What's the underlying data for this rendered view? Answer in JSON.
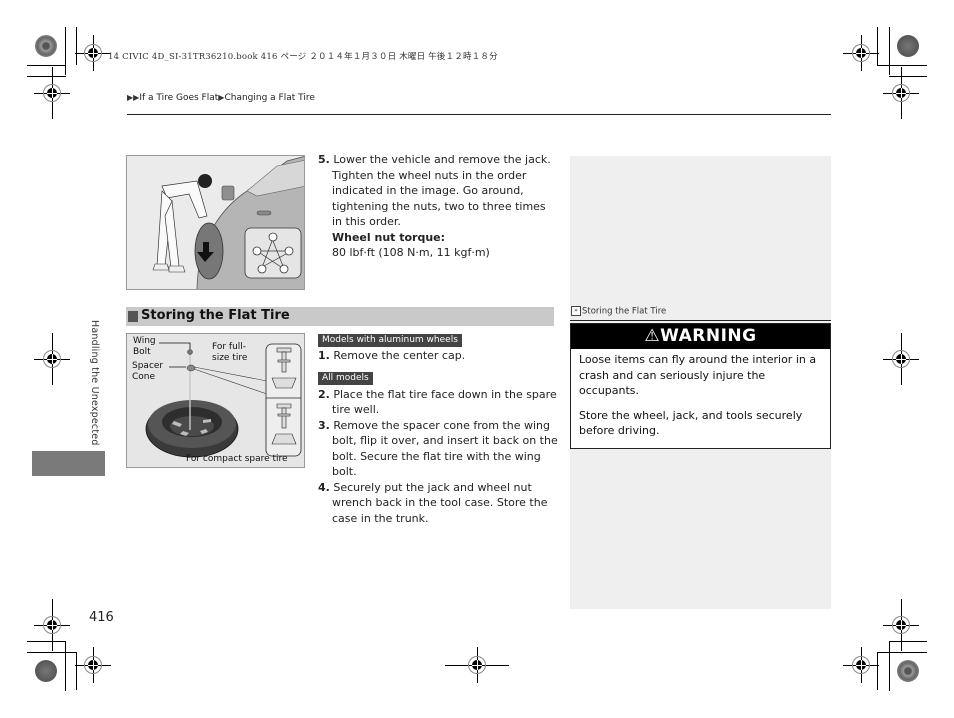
{
  "print_header": {
    "file_info": "14 CIVIC 4D_SI-31TR36210.book  416 ページ  ２０１４年１月３０日  木曜日  午後１２時１８分"
  },
  "breadcrumb": {
    "items": [
      "If a Tire Goes Flat",
      "Changing a Flat Tire"
    ],
    "separator_icon": "triangle-right-icon"
  },
  "side_tab": {
    "label": "Handling the Unexpected"
  },
  "illustration_1": {
    "alt": "Person lowering vehicle with jack; inset shows star-pattern wheel nut tightening order"
  },
  "step5": {
    "number": "5.",
    "text": "Lower the vehicle and remove the jack. Tighten the wheel nuts in the order indicated in the image. Go around, tightening the nuts, two to three times in this order.",
    "torque_label": "Wheel nut torque:",
    "torque_value": "80 lbf·ft (108 N·m, 11 kgf·m)"
  },
  "section": {
    "title": "Storing the Flat Tire"
  },
  "illustration_2": {
    "labels": {
      "wing_bolt": [
        "Wing",
        "Bolt"
      ],
      "spacer_cone": [
        "Spacer",
        "Cone"
      ],
      "full_size": [
        "For full-",
        "size tire"
      ],
      "compact": "For compact spare tire"
    }
  },
  "steps": {
    "badge_aluminum": "Models with aluminum wheels",
    "badge_all": "All models",
    "items": [
      {
        "number": "1.",
        "text": "Remove the center cap."
      },
      {
        "number": "2.",
        "text": "Place the flat tire face down in the spare tire well."
      },
      {
        "number": "3.",
        "text": "Remove the spacer cone from the wing bolt, flip it over, and insert it back on the bolt. Secure the flat tire with the wing bolt."
      },
      {
        "number": "4.",
        "text": "Securely put the jack and wheel nut wrench back in the tool case. Store the case in the trunk."
      }
    ]
  },
  "note": {
    "title": "Storing the Flat Tire",
    "icon": "reference-icon"
  },
  "warning": {
    "title": "WARNING",
    "paragraphs": [
      "Loose items can fly around the interior in a crash and can seriously injure the occupants.",
      "Store the wheel, jack, and tools securely before driving."
    ]
  },
  "page": {
    "number": "416"
  }
}
